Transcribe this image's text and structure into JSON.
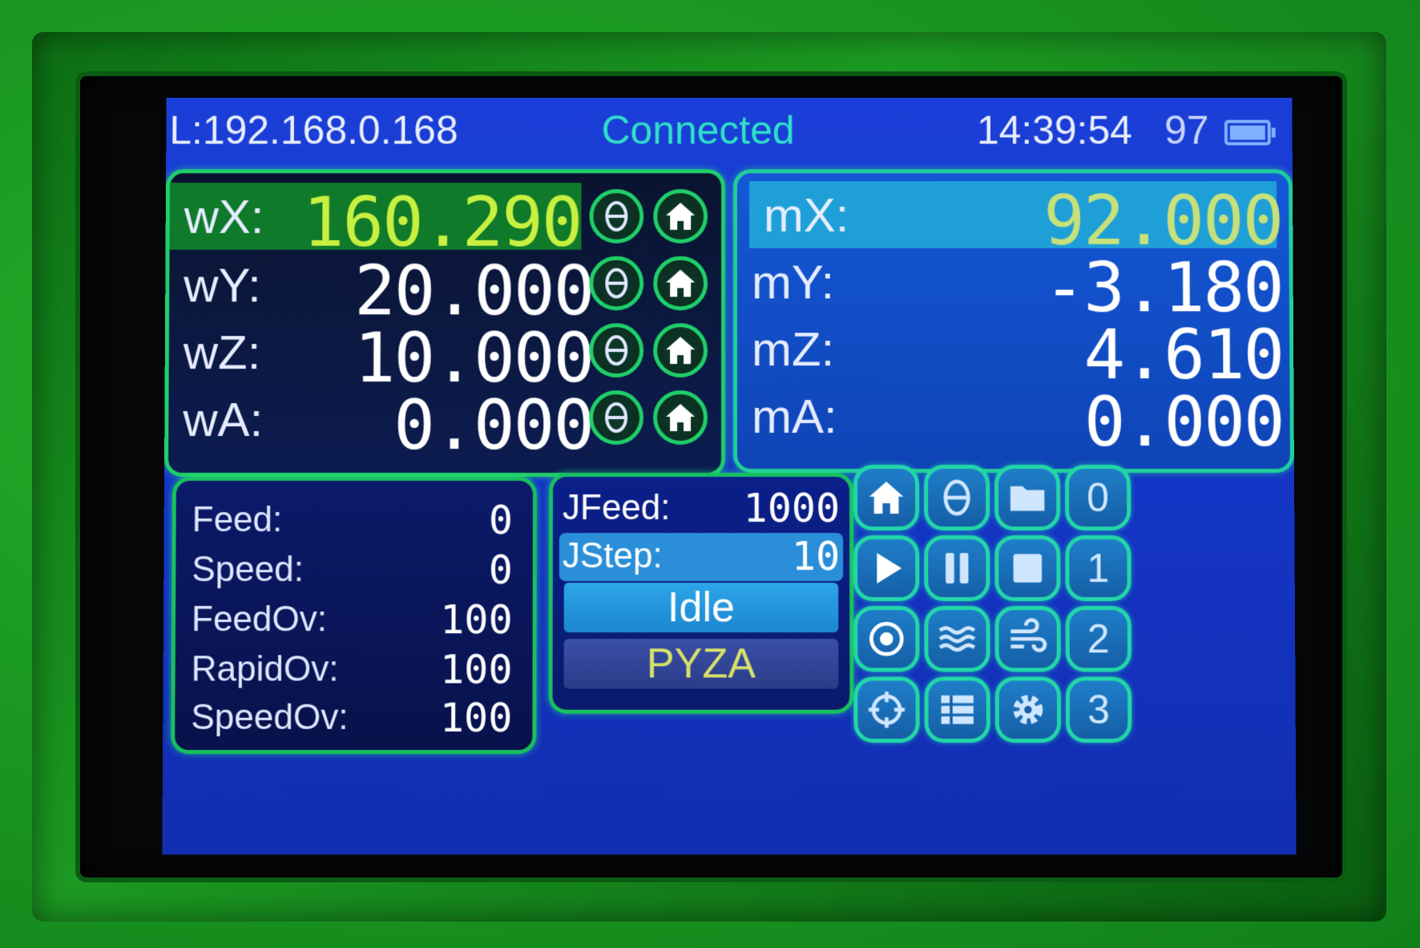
{
  "status_bar": {
    "ip": "L:192.168.0.168",
    "connection": "Connected",
    "clock": "14:39:54",
    "battery": "97"
  },
  "work_coords": [
    {
      "label": "wX:",
      "value": "160.290",
      "highlighted": true
    },
    {
      "label": "wY:",
      "value": "20.000",
      "highlighted": false
    },
    {
      "label": "wZ:",
      "value": "10.000",
      "highlighted": false
    },
    {
      "label": "wA:",
      "value": "0.000",
      "highlighted": false
    }
  ],
  "machine_coords": [
    {
      "label": "mX:",
      "value": "92.000",
      "highlighted": true
    },
    {
      "label": "mY:",
      "value": "-3.180",
      "highlighted": false
    },
    {
      "label": "mZ:",
      "value": "4.610",
      "highlighted": false
    },
    {
      "label": "mA:",
      "value": "0.000",
      "highlighted": false
    }
  ],
  "status": [
    {
      "label": "Feed:",
      "value": "0"
    },
    {
      "label": "Speed:",
      "value": "0"
    },
    {
      "label": "FeedOv:",
      "value": "100"
    },
    {
      "label": "RapidOv:",
      "value": "100"
    },
    {
      "label": "SpeedOv:",
      "value": "100"
    }
  ],
  "jog": {
    "feed_label": "JFeed:",
    "feed_value": "1000",
    "step_label": "JStep:",
    "step_value": "10",
    "state": "Idle",
    "axes": "PYZA"
  },
  "button_grid": {
    "digits": [
      "0",
      "1",
      "2",
      "3"
    ]
  },
  "colors": {
    "accent": "#1fcf6a",
    "screen_bg": "#1434c4",
    "highlight_value": "#c8f040",
    "connected": "#2fe0c8"
  }
}
